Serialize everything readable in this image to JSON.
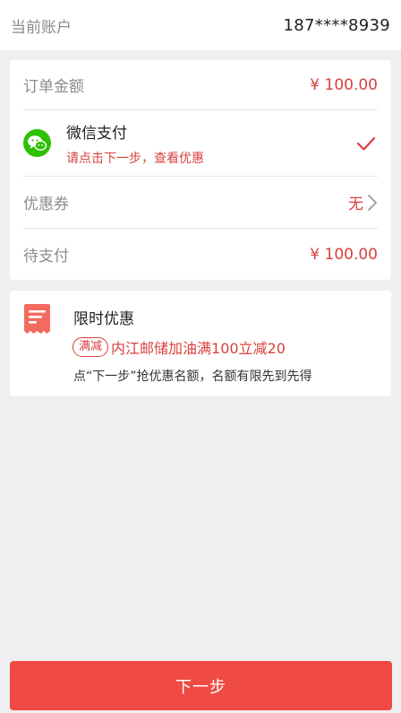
{
  "account": {
    "label": "当前账户",
    "value": "187****8939"
  },
  "order": {
    "amount_label": "订单金额",
    "amount_value": "¥ 100.00",
    "payment": {
      "name": "微信支付",
      "hint": "请点击下一步，查看优惠",
      "icon": "wechat-icon",
      "selected": true
    },
    "coupon_label": "优惠券",
    "coupon_value": "无",
    "due_label": "待支付",
    "due_value": "¥ 100.00"
  },
  "promo": {
    "title": "限时优惠",
    "badge": "满减",
    "offer": "内江邮储加油满100立减20",
    "note": "点“下一步”抢优惠名额，名额有限先到先得",
    "icon": "receipt-icon"
  },
  "actions": {
    "next_label": "下一步"
  },
  "colors": {
    "accent_red": "#d8403c",
    "button_red": "#f04a45",
    "wechat_green": "#2dc100",
    "background": "#efeff1"
  }
}
